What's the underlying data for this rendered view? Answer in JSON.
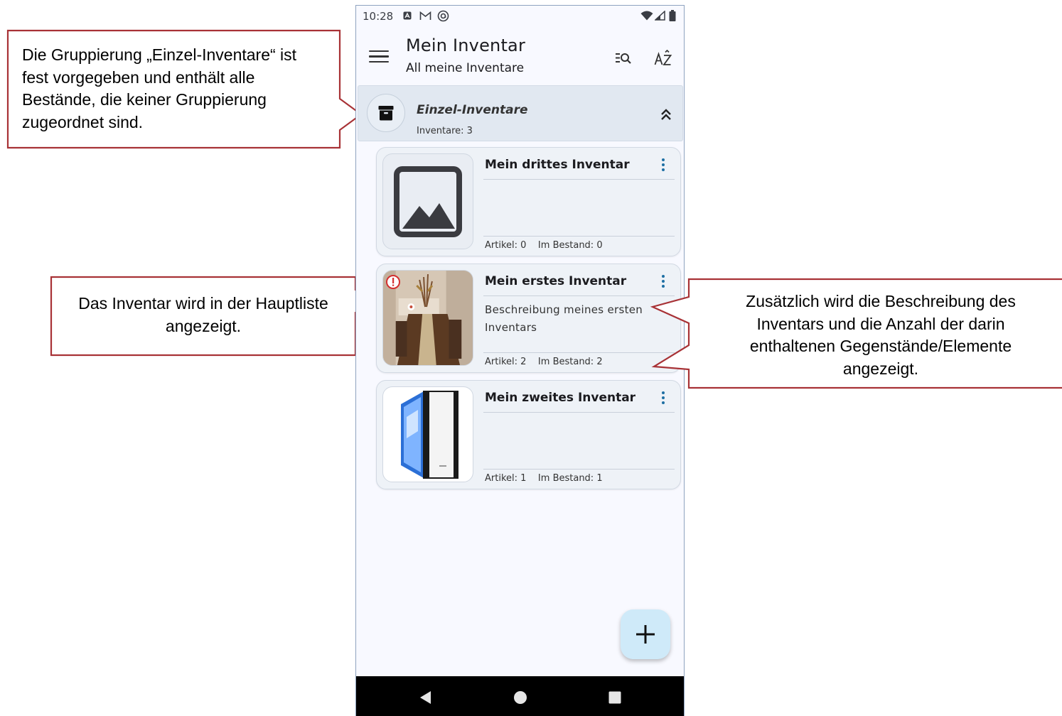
{
  "callouts": {
    "top_left": {
      "lines": [
        "Die Gruppierung „Einzel-Inventare“ ist",
        "fest vorgegeben und enthält alle",
        "Bestände, die keiner Gruppierung",
        "zugeordnet sind."
      ]
    },
    "mid_left": {
      "lines": [
        "Das Inventar wird in der Hauptliste",
        "angezeigt."
      ]
    },
    "right": {
      "lines": [
        "Zusätzlich wird die Beschreibung des",
        "Inventars und die Anzahl der darin",
        "enthaltenen Gegenstände/Elemente",
        "angezeigt."
      ]
    },
    "border_color": "#a83236"
  },
  "status_bar": {
    "time": "10:28",
    "icons": [
      "notification-a-icon",
      "gmail-icon",
      "sync-icon",
      "wifi-icon",
      "signal-icon",
      "battery-icon"
    ]
  },
  "app_bar": {
    "title": "Mein Inventar",
    "subtitle": "All meine Inventare",
    "actions": [
      "filter-search-icon",
      "sort-az-icon"
    ]
  },
  "group": {
    "name": "Einzel-Inventare",
    "count_label": "Inventare: 3",
    "icon": "archive-box-icon",
    "expanded": true
  },
  "inventories": [
    {
      "title": "Mein drittes Inventar",
      "description": "",
      "stats": "Artikel: 0    Im Bestand: 0",
      "thumbnail": "placeholder-image-icon",
      "has_alert": false
    },
    {
      "title": "Mein erstes Inventar",
      "description": "Beschreibung meines ersten Inventars",
      "stats": "Artikel: 2    Im Bestand: 2",
      "thumbnail": "dining-room-photo",
      "has_alert": true
    },
    {
      "title": "Mein zweites Inventar",
      "description": "",
      "stats": "Artikel: 1    Im Bestand: 1",
      "thumbnail": "pc-case-photo",
      "has_alert": false
    }
  ],
  "fab": {
    "icon": "plus-icon"
  },
  "nav_bar": {
    "buttons": [
      "back-icon",
      "home-icon",
      "recents-icon"
    ]
  },
  "colors": {
    "accent": "#1e6fa3",
    "group_bg": "#e1e8f1",
    "card_bg": "#eef2f7",
    "fab_bg": "#cfeaf9",
    "alert": "#d32f2f"
  }
}
